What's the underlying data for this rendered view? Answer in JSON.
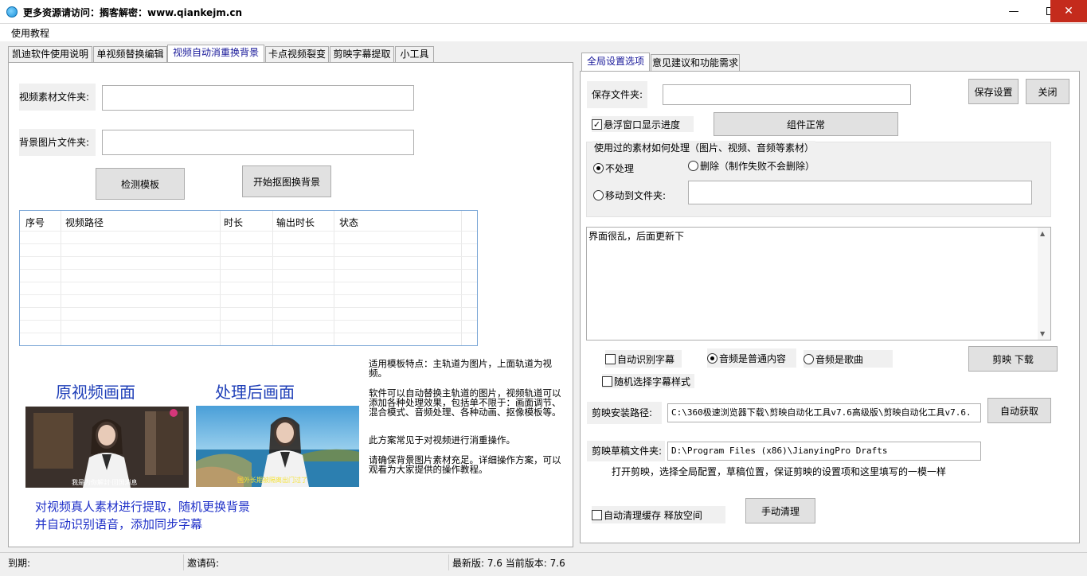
{
  "window": {
    "title": "更多资源请访问：搁客解密：www.qiankejm.cn"
  },
  "menu": {
    "tutorial": "使用教程"
  },
  "left_tabs": [
    "凯迪软件使用说明",
    "单视频替换编辑",
    "视频自动消重换背景",
    "卡点视频裂变",
    "剪映字幕提取",
    "小工具"
  ],
  "left_panel": {
    "video_folder_label": "视频素材文件夹:",
    "video_folder_value": "",
    "bg_folder_label": "背景图片文件夹:",
    "bg_folder_value": "",
    "detect_button": "检测模板",
    "start_button": "开始抠图换背景",
    "table": {
      "headers": [
        "序号",
        "视频路径",
        "时长",
        "输出时长",
        "状态"
      ],
      "rows": []
    },
    "preview": {
      "original_heading": "原视频画面",
      "processed_heading": "处理后画面",
      "thumb1_subtitle": "我是为你解封·回国消息",
      "thumb2_subtitle": "国外长期被隔离出门过了",
      "caption_line1": "对视频真人素材进行提取，随机更换背景",
      "caption_line2": "并自动识别语音，添加同步字幕"
    },
    "description": [
      "适用模板特点：主轨道为图片，上面轨道为视频。",
      "软件可以自动替换主轨道的图片，视频轨道可以添加各种处理效果，包括单不限于：画面调节、混合模式、音频处理、各种动画、抠像模板等。",
      "此方案常见于对视频进行消重操作。",
      "请确保背景图片素材充足。详细操作方案，可以观看为大家提供的操作教程。"
    ]
  },
  "right_tabs": [
    "全局设置选项",
    "意见建议和功能需求"
  ],
  "right_panel": {
    "save_folder_label": "保存文件夹:",
    "save_folder_value": "",
    "save_settings_button": "保存设置",
    "close_button": "关闭",
    "float_progress_label": "悬浮窗口显示进度",
    "float_progress_checked": true,
    "component_status_button": "组件正常",
    "group_title": "使用过的素材如何处理（图片、视频、音频等素材）",
    "opt_none": "不处理",
    "opt_delete": "删除（制作失败不会删除）",
    "opt_move": "移动到文件夹:",
    "move_folder_value": "",
    "notes_text": "界面很乱，后面更新下",
    "auto_subtitle": "自动识别字幕",
    "audio_normal": "音频是普通内容",
    "audio_song": "音频是歌曲",
    "jianying_download_button": "剪映 下载",
    "random_subtitle_style": "随机选择字幕样式",
    "install_path_label": "剪映安装路径:",
    "install_path_value": "C:\\360极速浏览器下载\\剪映自动化工具v7.6高级版\\剪映自动化工具v7.6.",
    "auto_get_button": "自动获取",
    "drafts_label": "剪映草稿文件夹:",
    "drafts_value": "D:\\Program Files (x86)\\JianyingPro Drafts",
    "drafts_hint": "打开剪映，选择全局配置，草稿位置，保证剪映的设置项和这里填写的一模一样",
    "auto_clean_cache": "自动清理缓存 释放空间",
    "manual_clean_button": "手动清理"
  },
  "status": {
    "expiry": "到期:",
    "invite": "邀请码:",
    "version": "最新版: 7.6 当前版本: 7.6"
  }
}
